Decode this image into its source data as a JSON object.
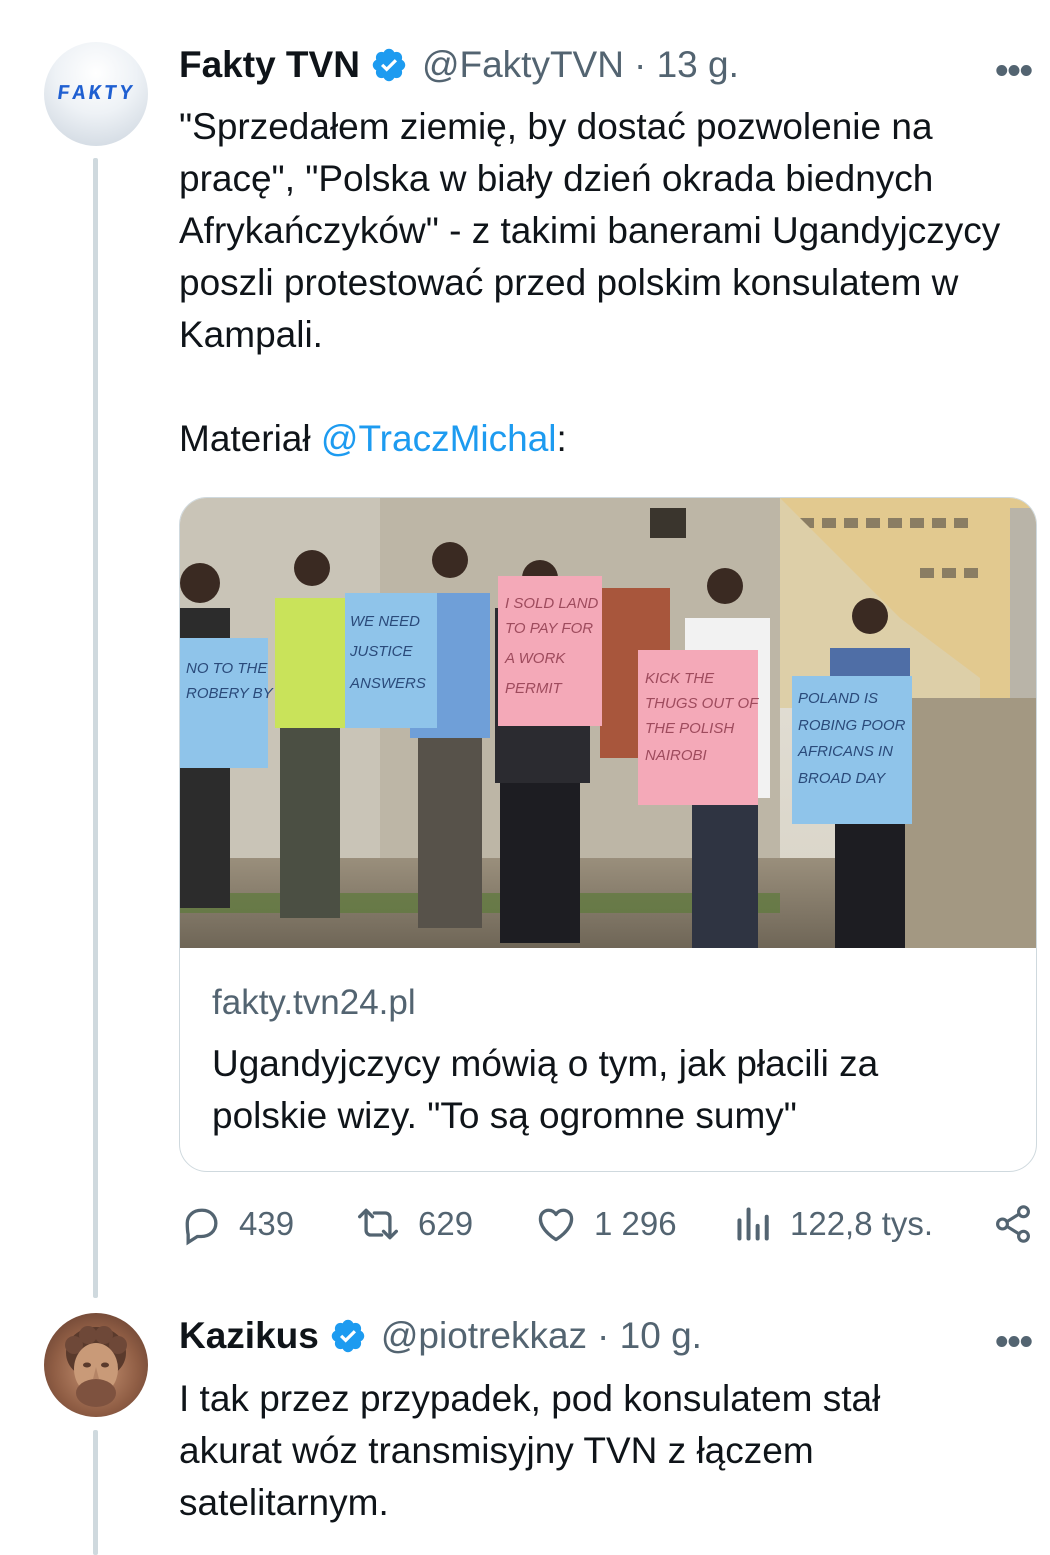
{
  "tweet1": {
    "author_name": "Fakty TVN",
    "handle": "@FaktyTVN",
    "time": "· 13 g.",
    "avatar_text": "FAKTY",
    "more": "•••",
    "text_main": "\"Sprzedałem ziemię, by dostać pozwolenie na pracę\", \"Polska w biały dzień okrada biednych Afrykańczyków\" - z takimi banerami Ugandyjczycy poszli protestować przed polskim konsulatem w Kampali.",
    "text_material_prefix": "Materiał ",
    "mention": "@TraczMichal",
    "text_material_suffix": ":",
    "card": {
      "domain": "fakty.tvn24.pl",
      "title": "Ugandyjczycy mówią o tym, jak płacili za polskie wizy. \"To są ogromne sumy\"",
      "signs": [
        "JESAY NO TO THE ROBERY BY POLAND",
        "WE NEED JUSTICE WE NEED ANSWERS",
        "I SOLD LAND TO PAY FOR A WORK PERMIT",
        "KICK THE THUGS OUT OF THE POLISH EMBASSY IN NAIROBI",
        "POLAND IS ROBING POOR AFRICANS IN BROAD DAY LIGHT"
      ]
    },
    "stats": {
      "replies": "439",
      "retweets": "629",
      "likes": "1 296",
      "views": "122,8 tys."
    }
  },
  "tweet2": {
    "author_name": "Kazikus",
    "handle": "@piotrekkaz",
    "time": "· 10 g.",
    "more": "•••",
    "text": "I tak przez przypadek, pod konsulatem stał akurat wóz transmisyjny TVN z łączem satelitarnym."
  },
  "colors": {
    "text": "#0f1419",
    "secondary": "#536471",
    "link": "#1d9bf0",
    "verified": "#1d9bf0",
    "thread_line": "#cfd9de",
    "border": "#cfd9de"
  },
  "icons": [
    "verified-badge-icon",
    "more-icon",
    "reply-icon",
    "retweet-icon",
    "like-icon",
    "views-icon",
    "share-icon"
  ]
}
